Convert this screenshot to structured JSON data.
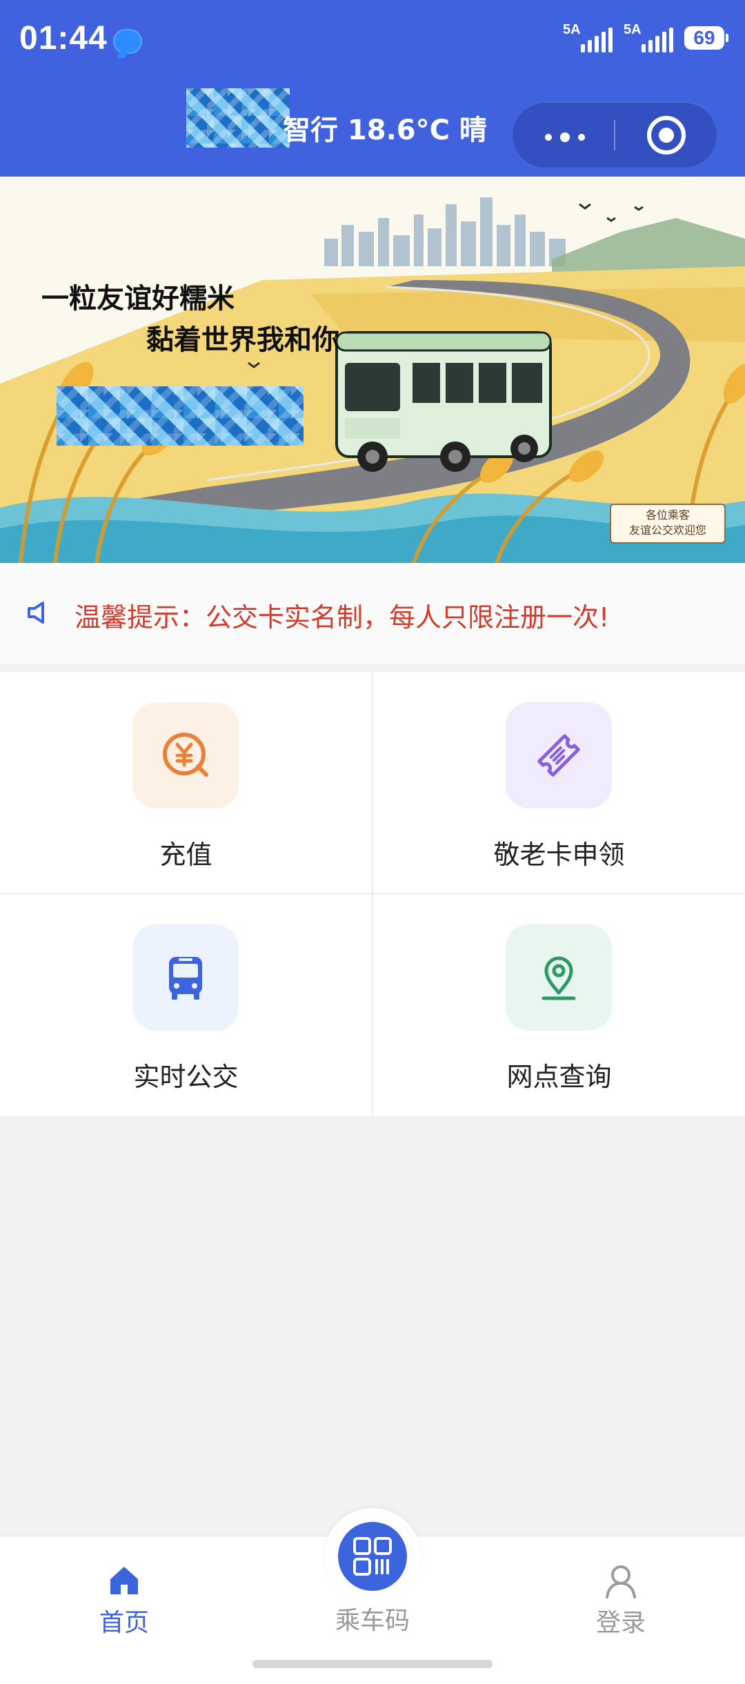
{
  "status_bar": {
    "time": "01:44",
    "signal1": "5A",
    "signal2": "5A",
    "battery": "69"
  },
  "header": {
    "title_suffix": "智行  18.6°C  晴"
  },
  "banner": {
    "line1": "一粒友谊好糯米",
    "line2": "黏着世界我和你",
    "sign_line1": "各位乘客",
    "sign_line2": "友谊公交欢迎您"
  },
  "notice": {
    "text": "温馨提示：公交卡实名制，每人只限注册一次!"
  },
  "services": [
    {
      "label": "充值",
      "icon": "yuan-coin-icon",
      "bg": "#fdf1e6",
      "color": "#e8823a"
    },
    {
      "label": "敬老卡申领",
      "icon": "ticket-icon",
      "bg": "#f1ecfd",
      "color": "#8a5ee0"
    },
    {
      "label": "实时公交",
      "icon": "bus-icon",
      "bg": "#ecf2fe",
      "color": "#3b64dd"
    },
    {
      "label": "网点查询",
      "icon": "location-pin-icon",
      "bg": "#e8f6ef",
      "color": "#2e9a63"
    }
  ],
  "tabbar": {
    "home": "首页",
    "ride_code": "乘车码",
    "login": "登录"
  },
  "colors": {
    "brand": "#4162df",
    "notice": "#d23b2c",
    "tab_active": "#3b64dd"
  }
}
